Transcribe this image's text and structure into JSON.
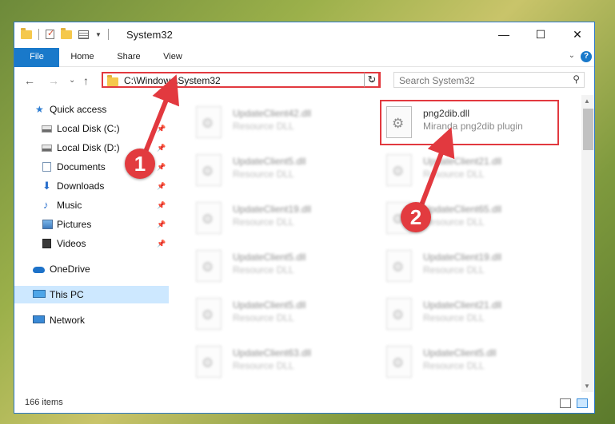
{
  "window": {
    "title": "System32"
  },
  "title_controls": {
    "minimize": "—",
    "maximize": "☐",
    "close": "✕"
  },
  "ribbon": {
    "tabs": [
      "File",
      "Home",
      "Share",
      "View"
    ],
    "expand": "⌄",
    "help": "?"
  },
  "nav": {
    "back": "←",
    "forward": "→",
    "recent": "⌄",
    "up": "↑"
  },
  "address": {
    "path": "C:\\Windows\\System32",
    "dropdown": "⌄",
    "refresh": "↻"
  },
  "search": {
    "placeholder": "Search System32",
    "icon": "search-icon"
  },
  "sidebar": {
    "quick_access": "Quick access",
    "items": [
      {
        "label": "Local Disk (C:)",
        "icon": "disk-icon"
      },
      {
        "label": "Local Disk (D:)",
        "icon": "disk-icon"
      },
      {
        "label": "Documents",
        "icon": "documents-icon"
      },
      {
        "label": "Downloads",
        "icon": "download-icon"
      },
      {
        "label": "Music",
        "icon": "music-icon"
      },
      {
        "label": "Pictures",
        "icon": "pictures-icon"
      },
      {
        "label": "Videos",
        "icon": "videos-icon"
      }
    ],
    "onedrive": "OneDrive",
    "this_pc": "This PC",
    "network": "Network"
  },
  "files": {
    "left": [
      {
        "name": "UpdateClient42.dll",
        "desc": "Resource DLL"
      },
      {
        "name": "UpdateClient5.dll",
        "desc": "Resource DLL"
      },
      {
        "name": "UpdateClient19.dll",
        "desc": "Resource DLL"
      },
      {
        "name": "UpdateClient5.dll",
        "desc": "Resource DLL"
      },
      {
        "name": "UpdateClient5.dll",
        "desc": "Resource DLL"
      },
      {
        "name": "UpdateClient63.dll",
        "desc": "Resource DLL"
      }
    ],
    "right": [
      {
        "name": "png2dib.dll",
        "desc": "Miranda png2dib plugin"
      },
      {
        "name": "UpdateClient21.dll",
        "desc": "Resource DLL"
      },
      {
        "name": "UpdateClient65.dll",
        "desc": "Resource DLL"
      },
      {
        "name": "UpdateClient19.dll",
        "desc": "Resource DLL"
      },
      {
        "name": "UpdateClient21.dll",
        "desc": "Resource DLL"
      },
      {
        "name": "UpdateClient5.dll",
        "desc": "Resource DLL"
      }
    ]
  },
  "status": {
    "count": "166 items"
  },
  "annotations": {
    "step1": "1",
    "step2": "2",
    "color": "#e2393f"
  }
}
